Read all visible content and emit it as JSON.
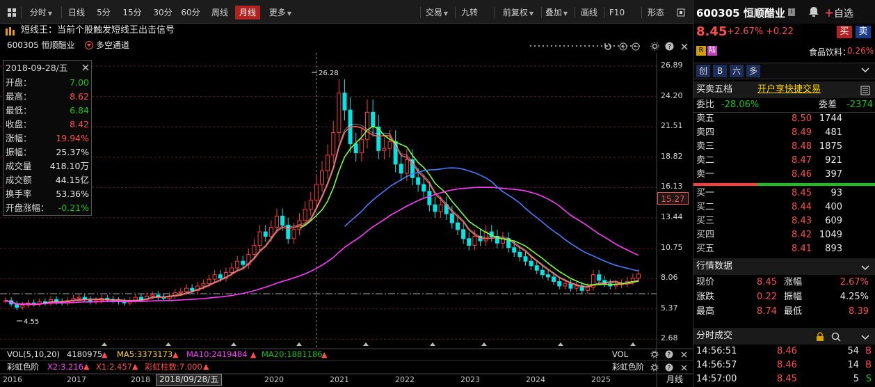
{
  "toolbar": {
    "left": [
      "分时",
      "日线",
      "5分",
      "15分",
      "30分",
      "60分",
      "周线",
      "月线",
      "更多"
    ],
    "active": "月线",
    "right": [
      "交易",
      "九转",
      "前复权",
      "叠加",
      "画线",
      "F10",
      "形态"
    ]
  },
  "signal": {
    "label": "短线王：当前个股触发短线王出击信号"
  },
  "chart_head": {
    "stock": "600305 恒顺醋业",
    "channel": "多空通道"
  },
  "infobox": {
    "date": "2018-09-28/五",
    "rows": [
      {
        "label": "开盘：",
        "value": "7.00",
        "color": "green"
      },
      {
        "label": "最高：",
        "value": "8.62",
        "color": "red"
      },
      {
        "label": "最低：",
        "value": "6.84",
        "color": "green"
      },
      {
        "label": "收盘：",
        "value": "8.42",
        "color": "red"
      },
      {
        "label": "涨幅：",
        "value": "19.94%",
        "color": "red"
      },
      {
        "label": "振幅：",
        "value": "25.37%",
        "color": "white"
      },
      {
        "label": "成交量",
        "value": "418.10万",
        "color": "white"
      },
      {
        "label": "成交额",
        "value": "44.15亿",
        "color": "white"
      },
      {
        "label": "换手率",
        "value": "53.36%",
        "color": "white"
      },
      {
        "label": "开盘涨幅：",
        "value": "-0.21%",
        "color": "green"
      }
    ]
  },
  "price_axis": [
    "26.89",
    "24.20",
    "21.51",
    "18.82",
    "16.13",
    "13.44",
    "10.75",
    "8.06",
    "5.37",
    "2.68"
  ],
  "current_price_tag": "15.27",
  "chart_labels": {
    "high": "26.28",
    "low": "4.55"
  },
  "vol_bar": {
    "label": "VOL(5,10,20)",
    "vol": "4180975",
    "ma5": "MA5:3373173",
    "ma10": "MA10:2419484",
    "ma20": "MA20:1881186",
    "right": "VOL"
  },
  "rainbow_bar": {
    "label": "彩虹色阶",
    "x2": "X2:3.216",
    "x1": "X1:2.457",
    "bar": "彩虹柱数:7.000",
    "right": "彩虹色阶"
  },
  "time_axis": {
    "years": [
      "2016",
      "2017",
      "2018",
      "2020",
      "2021",
      "2022",
      "2023",
      "2024",
      "2025"
    ],
    "cursor_date": "2018/09/28/五",
    "period": "月线"
  },
  "colors": {
    "up": "#ff3b3b",
    "down": "#00e0e0",
    "ma5": "#ffffff",
    "ma10": "#ffd700",
    "ma20": "#ff00ff",
    "accent": "#b22222"
  },
  "quote": {
    "code_name": "600305 恒顺醋业",
    "add_label": "自选",
    "price": "8.45",
    "change_pct": "+2.67%",
    "change": "+0.22",
    "buy": "买",
    "sell": "卖",
    "tag_r": "R",
    "tag_lu": "陆",
    "sector": "食品饮料：",
    "sector_pct": "0.26%",
    "tabs": [
      "创",
      "B",
      "六",
      "多"
    ]
  },
  "orderbook": {
    "title": "买卖五档",
    "link": "开户享快捷交易",
    "webi_label": "委比",
    "webi_value": "-28.06%",
    "weicha_label": "委差",
    "weicha_value": "-2374",
    "asks": [
      {
        "label": "卖五",
        "price": "8.50",
        "vol": "1744"
      },
      {
        "label": "卖四",
        "price": "8.49",
        "vol": "481"
      },
      {
        "label": "卖三",
        "price": "8.48",
        "vol": "1875"
      },
      {
        "label": "卖二",
        "price": "8.47",
        "vol": "921"
      },
      {
        "label": "卖一",
        "price": "8.46",
        "vol": "397"
      }
    ],
    "bids": [
      {
        "label": "买一",
        "price": "8.45",
        "vol": "93"
      },
      {
        "label": "买二",
        "price": "8.44",
        "vol": "400"
      },
      {
        "label": "买三",
        "price": "8.43",
        "vol": "609"
      },
      {
        "label": "买四",
        "price": "8.42",
        "vol": "1049"
      },
      {
        "label": "买五",
        "price": "8.41",
        "vol": "893"
      }
    ]
  },
  "market": {
    "title": "行情数据",
    "rows": [
      {
        "l1": "现价",
        "v1": "8.45",
        "l2": "涨幅",
        "v2": "2.67%",
        "c1": "red",
        "c2": "red"
      },
      {
        "l1": "涨跌",
        "v1": "0.22",
        "l2": "振幅",
        "v2": "4.25%",
        "c1": "red",
        "c2": "white"
      },
      {
        "l1": "最高",
        "v1": "8.74",
        "l2": "最低",
        "v2": "8.39",
        "c1": "red",
        "c2": "red"
      }
    ]
  },
  "ticks": {
    "title": "分时成交",
    "rows": [
      {
        "time": "14:56:51",
        "price": "8.46",
        "vol": "54",
        "side": "B"
      },
      {
        "time": "14:56:57",
        "price": "8.46",
        "vol": "14",
        "side": "B"
      },
      {
        "time": "14:57:00",
        "price": "8.45",
        "vol": "5",
        "side": "S"
      }
    ]
  }
}
